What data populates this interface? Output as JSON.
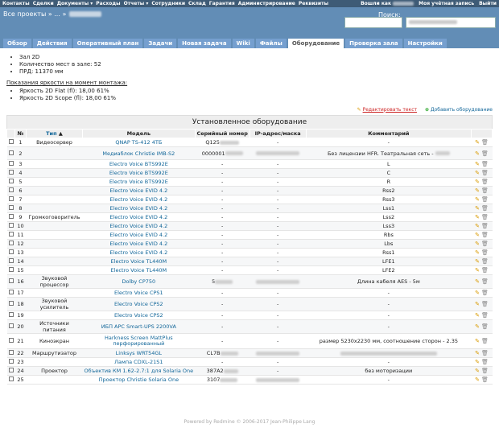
{
  "top_menu": {
    "items": [
      "Контакты",
      "Сделки",
      "Документы",
      "Расходы",
      "Отчеты",
      "Сотрудники",
      "Склад",
      "Гарантия",
      "Администрирование",
      "Реквизиты"
    ],
    "logged_as": "Вошли как",
    "my_account": "Моя учётная запись",
    "logout": "Выйти"
  },
  "header": {
    "projects": "Все проекты » ... »",
    "search_label": "Поиск:"
  },
  "tabs": [
    "Обзор",
    "Действия",
    "Оперативный план",
    "Задачи",
    "Новая задача",
    "Wiki",
    "Файлы",
    "Оборудование",
    "Проверка зала",
    "Настройки"
  ],
  "selected_tab": "Оборудование",
  "props": [
    "Зал 2D",
    "Количество мест в зале: 52",
    "ПРД: 11370 мм"
  ],
  "brightness": {
    "title": "Показания яркости на момент монтажа:",
    "items": [
      "Яркость 2D Flat (fl): 18,00 61%",
      "Яркость 2D Scope (fl): 18,00 61%"
    ]
  },
  "actions": {
    "edit": "Редактировать текст",
    "add": "Добавить оборудование"
  },
  "table": {
    "caption": "Установленное оборудование",
    "headers": {
      "num": "№",
      "type": "Тип",
      "model": "Модель",
      "serial": "Серийный номер",
      "ip": "IP-адрес/маска",
      "comment": "Комментарий"
    },
    "rows": [
      {
        "n": "1",
        "type": "Видеосервер",
        "model": "QNAP TS-412 4ТБ",
        "serial": "Q125",
        "ip": "-",
        "comment": "-"
      },
      {
        "n": "2",
        "type": "",
        "model": "Медиаблок Christie IMB-S2",
        "serial": "0000001",
        "ip": "",
        "comment": "Без лицензии HFR. Театральная сеть -"
      },
      {
        "n": "3",
        "type": "",
        "model": "Electro Voice BTS992E",
        "serial": "-",
        "ip": "-",
        "comment": "L"
      },
      {
        "n": "4",
        "type": "",
        "model": "Electro Voice BTS992E",
        "serial": "-",
        "ip": "-",
        "comment": "C"
      },
      {
        "n": "5",
        "type": "",
        "model": "Electro Voice BTS992E",
        "serial": "-",
        "ip": "-",
        "comment": "R"
      },
      {
        "n": "6",
        "type": "",
        "model": "Electro Voice EVID 4.2",
        "serial": "-",
        "ip": "-",
        "comment": "Rss2"
      },
      {
        "n": "7",
        "type": "",
        "model": "Electro Voice EVID 4.2",
        "serial": "-",
        "ip": "-",
        "comment": "Rss3"
      },
      {
        "n": "8",
        "type": "",
        "model": "Electro Voice EVID 4.2",
        "serial": "-",
        "ip": "-",
        "comment": "Lss1"
      },
      {
        "n": "9",
        "type": "Громкоговоритель",
        "model": "Electro Voice EVID 4.2",
        "serial": "-",
        "ip": "-",
        "comment": "Lss2"
      },
      {
        "n": "10",
        "type": "",
        "model": "Electro Voice EVID 4.2",
        "serial": "-",
        "ip": "-",
        "comment": "Lss3"
      },
      {
        "n": "11",
        "type": "",
        "model": "Electro Voice EVID 4.2",
        "serial": "-",
        "ip": "-",
        "comment": "Rbs"
      },
      {
        "n": "12",
        "type": "",
        "model": "Electro Voice EVID 4.2",
        "serial": "-",
        "ip": "-",
        "comment": "Lbs"
      },
      {
        "n": "13",
        "type": "",
        "model": "Electro Voice EVID 4.2",
        "serial": "-",
        "ip": "-",
        "comment": "Rss1"
      },
      {
        "n": "14",
        "type": "",
        "model": "Electro Voice TL440M",
        "serial": "-",
        "ip": "-",
        "comment": "LFE1"
      },
      {
        "n": "15",
        "type": "",
        "model": "Electro Voice TL440M",
        "serial": "-",
        "ip": "-",
        "comment": "LFE2"
      },
      {
        "n": "16",
        "type": "Звуковой процессор",
        "model": "Dolby CP750",
        "serial": "5",
        "ip": "",
        "comment": "Длина кабеля AES - 5м"
      },
      {
        "n": "17",
        "type": "",
        "model": "Electro Voice CPS1",
        "serial": "-",
        "ip": "-",
        "comment": "-"
      },
      {
        "n": "18",
        "type": "Звуковой усилитель",
        "model": "Electro Voice CPS2",
        "serial": "-",
        "ip": "-",
        "comment": "-"
      },
      {
        "n": "19",
        "type": "",
        "model": "Electro Voice CPS2",
        "serial": "-",
        "ip": "-",
        "comment": "-"
      },
      {
        "n": "20",
        "type": "Источники питания",
        "model": "ИБП APC Smart-UPS 2200VA",
        "serial": "-",
        "ip": "-",
        "comment": "-"
      },
      {
        "n": "21",
        "type": "Киноэкран",
        "model": "Harkness Screen MattPlus перфорированный",
        "serial": "-",
        "ip": "-",
        "comment": "размер 5230х2230 мм, соотношение сторон - 2.35"
      },
      {
        "n": "22",
        "type": "Маршрутизатор",
        "model": "Linksys WRT54GL",
        "serial": "CL7B",
        "ip": "",
        "comment": ""
      },
      {
        "n": "23",
        "type": "",
        "model": "Лампа CDXL-21S1",
        "serial": "-",
        "ip": "-",
        "comment": "-"
      },
      {
        "n": "24",
        "type": "Проектор",
        "model": "Объектив КМ 1.62-2.7:1 для Solaria One",
        "serial": "387A2",
        "ip": "-",
        "comment": "без моторизации"
      },
      {
        "n": "25",
        "type": "",
        "model": "Проектор Christie Solaria One",
        "serial": "3107",
        "ip": "",
        "comment": "-"
      }
    ]
  },
  "footer": "Powered by Redmine © 2006-2017 Jean-Philippe Lang"
}
